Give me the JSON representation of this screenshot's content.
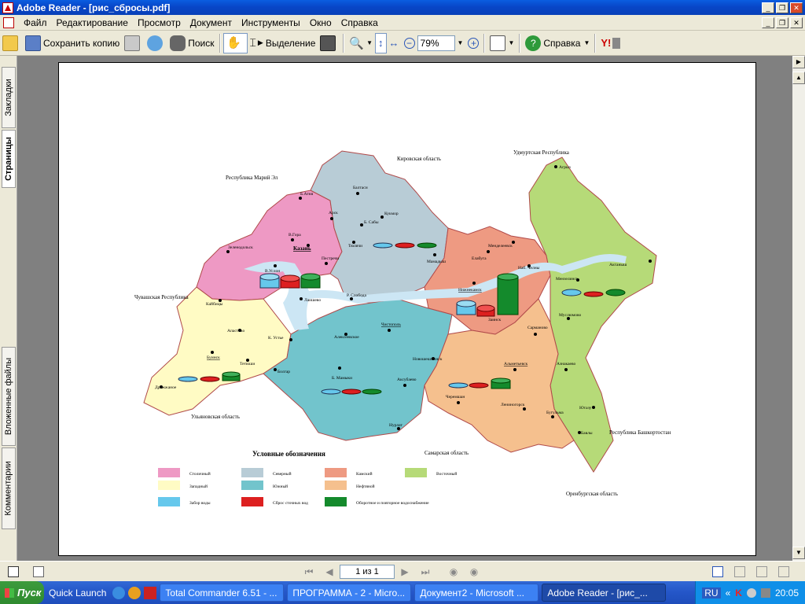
{
  "window": {
    "title": "Adobe Reader - [рис_сбросы.pdf]",
    "min": "_",
    "max": "❐",
    "close": "✕"
  },
  "menu": [
    "Файл",
    "Редактирование",
    "Просмотр",
    "Документ",
    "Инструменты",
    "Окно",
    "Справка"
  ],
  "toolbar": {
    "save_copy": "Сохранить копию",
    "search": "Поиск",
    "selection": "Выделение",
    "zoom": "79%",
    "help": "Справка"
  },
  "sidebar_tabs": [
    "Закладки",
    "Страницы",
    "Вложенные файлы",
    "Комментарии"
  ],
  "status": {
    "page": "1 из 1"
  },
  "map": {
    "neighbors": {
      "kirov": "Кировская область",
      "mari": "Республика Марий Эл",
      "udmurt": "Удмуртская Республика",
      "chuvash": "Чувашская Республика",
      "ulyanovsk": "Ульяновская область",
      "samara": "Самарская область",
      "orenburg": "Оренбургская область",
      "bashkortostan": "Республика Башкортостан"
    },
    "towns": {
      "kazan": "Казань",
      "batly": "Балтаси",
      "kukmor": "Кукмор",
      "arsk": "Арск",
      "b_atnya": "Б.Атня",
      "v_gora": "В.Гора",
      "zelenodolsk": "Зеленодольск",
      "v_uslon": "В.Услон",
      "pestrechi": "Пестречи",
      "laishevo": "Лаишево",
      "b_saby": "Б. Сабы",
      "tyulyachi": "Тюлячи",
      "mamadysh": "Мамадыш",
      "r_sloboda": "Р. Слобода",
      "agryz": "Агрыз",
      "mendeleevsk": "Менделеевск",
      "elabuga": "Елабуга",
      "nab_chelny": "Наб. Челны",
      "nizhnekamsk": "Нижнекамск",
      "zainsk": "Заинск",
      "menzelinsk": "Мензелинск",
      "aktanysh": "Актаныш",
      "muslyumovo": "Муслюмово",
      "sarmanovo": "Сарманово",
      "almetyevsk": "Альметьевск",
      "aznakaevo": "Азнакаево",
      "bavly": "Бавлы",
      "bugulma": "Бугульма",
      "yutaza": "Ютазу",
      "leninogorsk": "Лениногорск",
      "cheremshan": "Черемшан",
      "nurlat": "Нурлат",
      "aksubaevo": "Аксубаево",
      "novosheshminsk": "Новошешминск",
      "chistopol": "Чистополь",
      "alekseevskoe": "Алексеевское",
      "b_mamyki": "Б. Мамыки",
      "alkeevo": "Алькеево",
      "spassk": "Болгар",
      "k_ustye": "К. Устье",
      "apastovo": "Апастово",
      "kaybitsy": "Кайбицы",
      "tetyushi": "Тетюши",
      "buinsk": "Буинск",
      "drozhzhanoe": "Дрожжаное"
    },
    "legend": {
      "title": "Условные обозначения",
      "capital": "Столичный",
      "northern": "Северный",
      "kama": "Камский",
      "eastern": "Восточный",
      "western": "Западный",
      "southern": "Южный",
      "oil": "Нефтяной",
      "withdrawal": "Забор воды",
      "discharge": "Сброс сточных вод",
      "recycling": "Оборотное и повторное водоснабжение"
    }
  },
  "taskbar": {
    "start": "Пуск",
    "quick_launch": "Quick Launch",
    "tasks": [
      "Total Commander 6.51 - ...",
      "ПРОГРАММА - 2 - Micro...",
      "Документ2 - Microsoft ...",
      "Adobe Reader - [рис_..."
    ],
    "lang": "RU",
    "time": "20:05"
  },
  "colors": {
    "capital": "#EE99C4",
    "northern": "#B8CCD6",
    "kama": "#EE9A82",
    "eastern": "#B6DA78",
    "western": "#FFFBC4",
    "southern": "#72C4CC",
    "oil": "#F5C08E",
    "water": "#CCE6F4",
    "withdrawal": "#66C8EC",
    "discharge": "#DD2020",
    "recycling": "#148A2C"
  }
}
